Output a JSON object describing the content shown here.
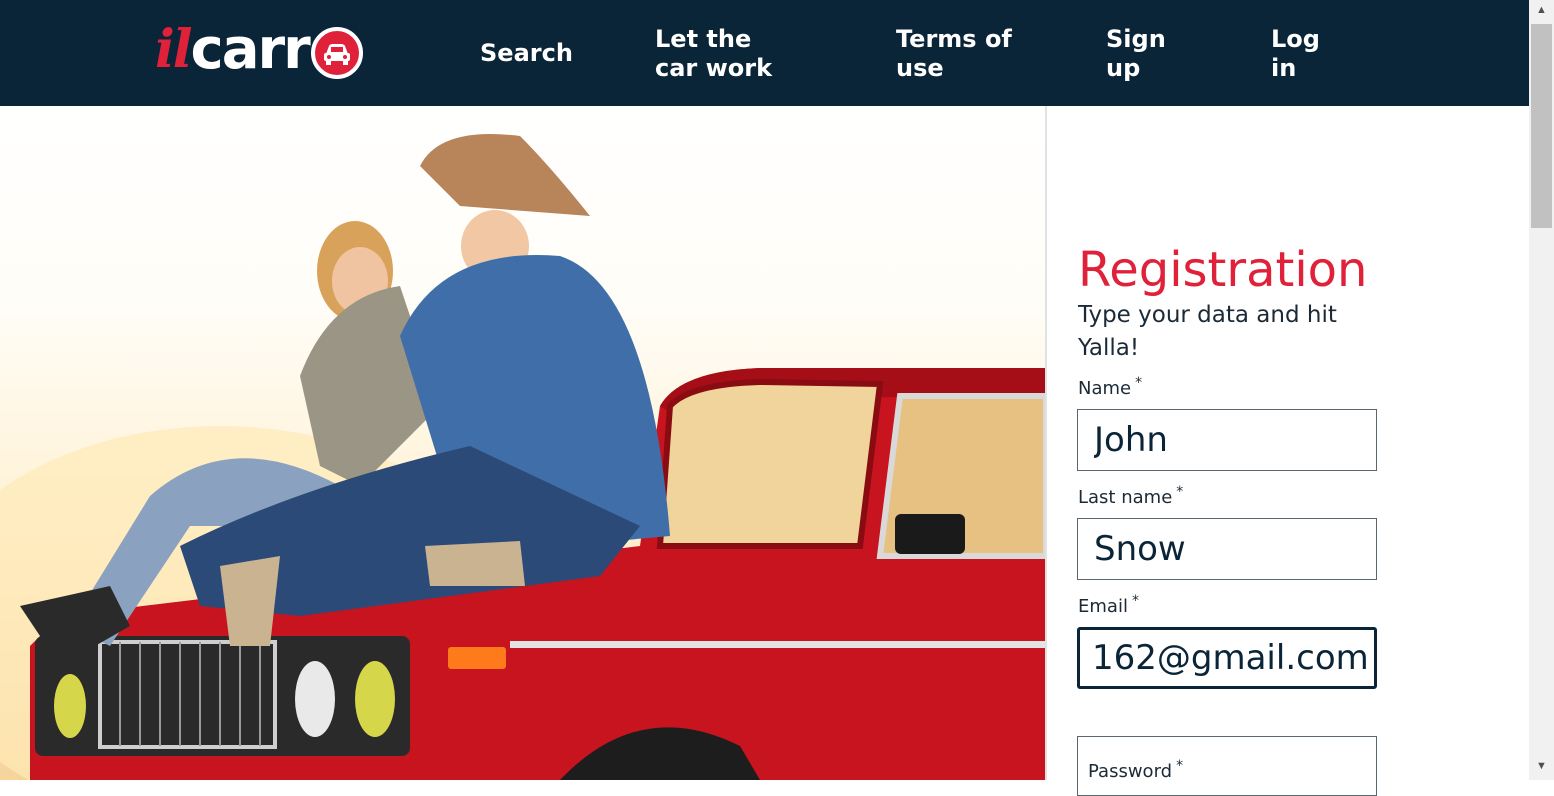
{
  "header": {
    "logo": {
      "part_il": "il",
      "part_carr": "carr"
    },
    "nav": {
      "search": "Search",
      "let_the_car_work": "Let the car work",
      "terms_of_use": "Terms of use",
      "sign_up": "Sign up",
      "log_in": "Log in"
    }
  },
  "form": {
    "title": "Registration",
    "subtitle": "Type your data and hit Yalla!",
    "name_label": "Name",
    "name_value": "John",
    "lastname_label": "Last name",
    "lastname_value": "Snow",
    "email_label": "Email",
    "email_value": "162@gmail.com",
    "password_label": "Password",
    "required_mark": "*"
  },
  "colors": {
    "header_bg": "#0b2538",
    "accent": "#e0213a",
    "car_red": "#c8141e"
  },
  "icons": [
    "car-logo-icon",
    "scroll-up-icon",
    "scroll-down-icon"
  ]
}
